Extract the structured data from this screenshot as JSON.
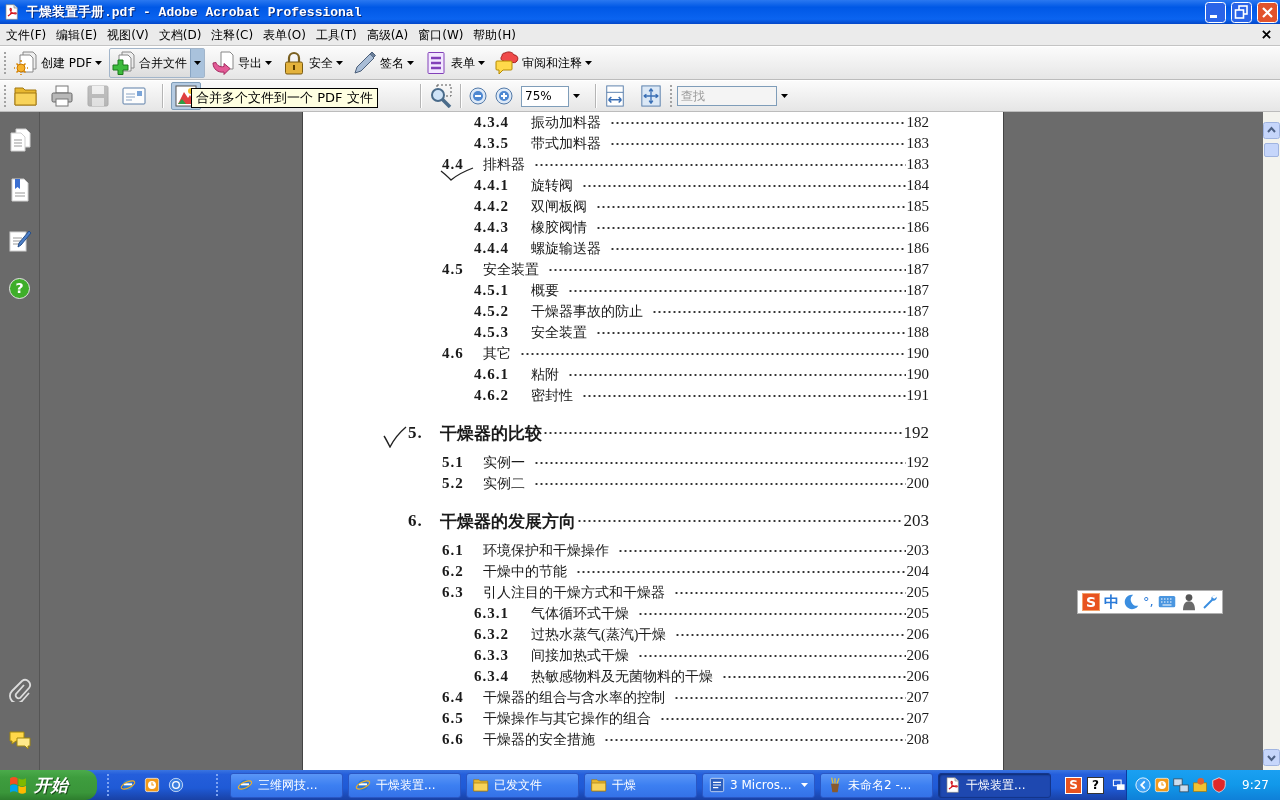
{
  "window": {
    "title": "干燥装置手册.pdf - Adobe Acrobat Professional"
  },
  "menu": [
    "文件(F)",
    "编辑(E)",
    "视图(V)",
    "文档(D)",
    "注释(C)",
    "表单(O)",
    "工具(T)",
    "高级(A)",
    "窗口(W)",
    "帮助(H)"
  ],
  "task_toolbar": [
    {
      "label": "创建 PDF",
      "highlighted": false
    },
    {
      "label": "合并文件",
      "highlighted": true
    },
    {
      "label": "导出",
      "highlighted": false
    },
    {
      "label": "安全",
      "highlighted": false
    },
    {
      "label": "签名",
      "highlighted": false
    },
    {
      "label": "表单",
      "highlighted": false
    },
    {
      "label": "审阅和注释",
      "highlighted": false
    }
  ],
  "file_toolbar": [
    {
      "disabled": false,
      "pressed": false
    },
    {
      "disabled": false,
      "pressed": false
    },
    {
      "disabled": true,
      "pressed": false
    },
    {
      "disabled": false,
      "pressed": false
    },
    {
      "disabled": false,
      "pressed": true
    }
  ],
  "tooltip": "合并多个文件到一个 PDF 文件",
  "zoom": {
    "value": "75%"
  },
  "search": {
    "placeholder": "查找"
  },
  "navigation_pane": {
    "help": "?"
  },
  "document": {
    "toc": [
      {
        "children": [
          {
            "children": [
              {
                "number": "4.3.4",
                "title": "振动加料器",
                "page": "182",
                "ticked": false
              },
              {
                "number": "4.3.5",
                "title": "带式加料器",
                "page": "183",
                "ticked": false
              }
            ]
          },
          {
            "number": "4.4",
            "title": "排料器",
            "page": "183",
            "ticked": true,
            "children": [
              {
                "number": "4.4.1",
                "title": "旋转阀",
                "page": "184",
                "ticked": false
              },
              {
                "number": "4.4.2",
                "title": "双闸板阀",
                "page": "185",
                "ticked": false
              },
              {
                "number": "4.4.3",
                "title": "橡胶阀情",
                "page": "186",
                "ticked": false
              },
              {
                "number": "4.4.4",
                "title": "螺旋输送器",
                "page": "186",
                "ticked": false
              }
            ]
          },
          {
            "number": "4.5",
            "title": "安全装置",
            "page": "187",
            "ticked": false,
            "children": [
              {
                "number": "4.5.1",
                "title": "概要",
                "page": "187",
                "ticked": false
              },
              {
                "number": "4.5.2",
                "title": "干燥器事故的防止",
                "page": "187",
                "ticked": false
              },
              {
                "number": "4.5.3",
                "title": "安全装置",
                "page": "188",
                "ticked": false
              }
            ]
          },
          {
            "number": "4.6",
            "title": "其它",
            "page": "190",
            "ticked": false,
            "children": [
              {
                "number": "4.6.1",
                "title": "粘附",
                "page": "190",
                "ticked": false
              },
              {
                "number": "4.6.2",
                "title": "密封性",
                "page": "191",
                "ticked": false
              }
            ]
          }
        ]
      },
      {
        "number": "5.",
        "title": "干燥器的比较",
        "page": "192",
        "ticked": true,
        "children": [
          {
            "number": "5.1",
            "title": "实例一",
            "page": "192",
            "ticked": false
          },
          {
            "number": "5.2",
            "title": "实例二",
            "page": "200",
            "ticked": false
          }
        ]
      },
      {
        "number": "6.",
        "title": "干燥器的发展方向",
        "page": "203",
        "ticked": false,
        "children": [
          {
            "number": "6.1",
            "title": "环境保护和干燥操作",
            "page": "203",
            "ticked": false
          },
          {
            "number": "6.2",
            "title": "干燥中的节能",
            "page": "204",
            "ticked": false
          },
          {
            "number": "6.3",
            "title": "引人注目的干燥方式和干燥器",
            "page": "205",
            "ticked": false,
            "children": [
              {
                "number": "6.3.1",
                "title": "气体循环式干燥",
                "page": "205",
                "ticked": false
              },
              {
                "number": "6.3.2",
                "title": "过热水蒸气(蒸汽)干燥",
                "page": "206",
                "ticked": false
              },
              {
                "number": "6.3.3",
                "title": "间接加热式干燥",
                "page": "206",
                "ticked": false
              },
              {
                "number": "6.3.4",
                "title": "热敏感物料及无菌物料的干燥",
                "page": "206",
                "ticked": false
              }
            ]
          },
          {
            "number": "6.4",
            "title": "干燥器的组合与含水率的控制",
            "page": "207",
            "ticked": false
          },
          {
            "number": "6.5",
            "title": "干燥操作与其它操作的组合",
            "page": "207",
            "ticked": false
          },
          {
            "number": "6.6",
            "title": "干燥器的安全措施",
            "page": "208",
            "ticked": false
          }
        ]
      }
    ]
  },
  "ime_bar": {
    "logo": "S",
    "mode": "中",
    "punctuation": "°,"
  },
  "taskbar": {
    "start": "开始",
    "tasks": [
      {
        "label": "三维网技...",
        "selected": false,
        "grouped": false
      },
      {
        "label": "干燥装置...",
        "selected": false,
        "grouped": false
      },
      {
        "label": "已发文件",
        "selected": false,
        "grouped": false
      },
      {
        "label": "干燥",
        "selected": false,
        "grouped": false
      },
      {
        "label": "3 Micros...",
        "selected": false,
        "grouped": true
      },
      {
        "label": "未命名2 -...",
        "selected": false,
        "grouped": false
      },
      {
        "label": "干燥装置...",
        "selected": true,
        "grouped": false
      }
    ],
    "tray": {
      "ime_logo": "S",
      "help": "?"
    },
    "clock": "9:27"
  }
}
